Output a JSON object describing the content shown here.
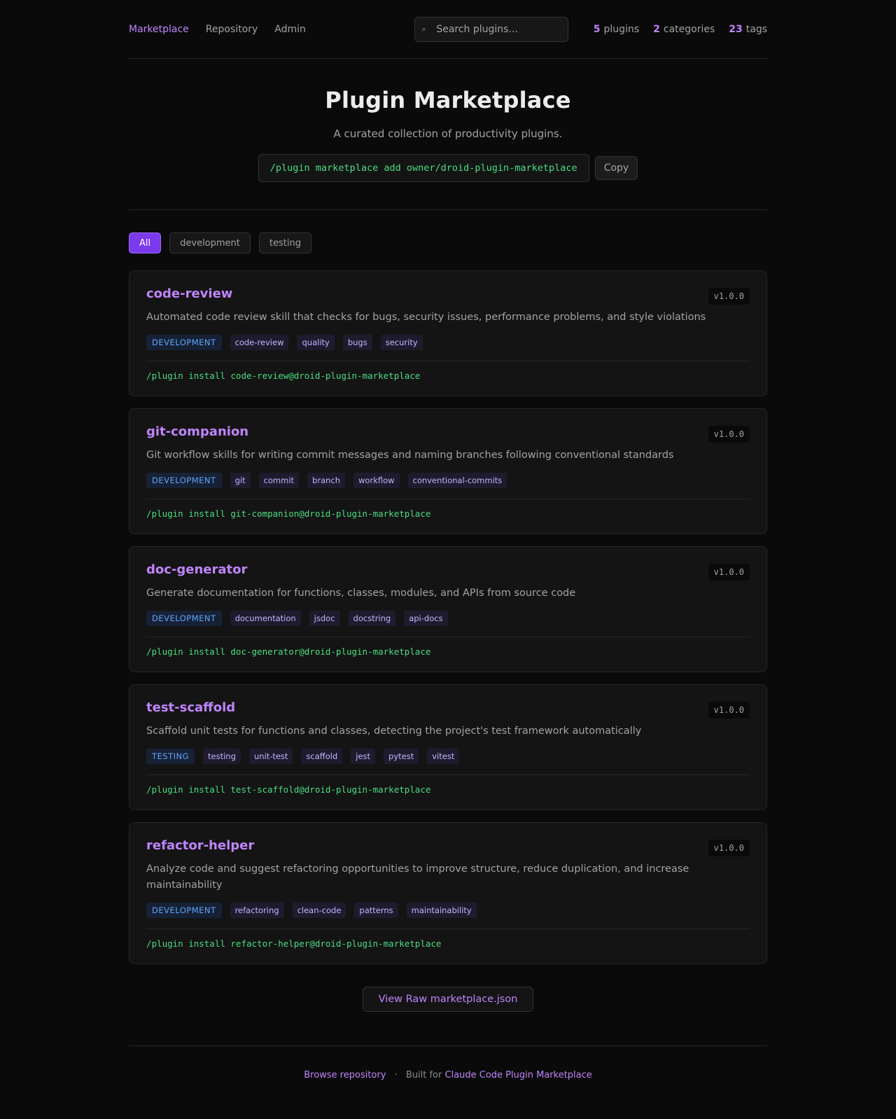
{
  "nav": {
    "links": [
      {
        "label": "Marketplace",
        "active": true
      },
      {
        "label": "Repository",
        "active": false
      },
      {
        "label": "Admin",
        "active": false
      }
    ],
    "search": {
      "icon": "search-icon",
      "placeholder": "Search plugins..."
    },
    "stats": [
      {
        "value": "5",
        "label": "plugins"
      },
      {
        "value": "2",
        "label": "categories"
      },
      {
        "value": "23",
        "label": "tags"
      }
    ]
  },
  "hero": {
    "title": "Plugin Marketplace",
    "subtitle": "A curated collection of productivity plugins.",
    "command": "/plugin marketplace add owner/droid-plugin-marketplace",
    "copy_label": "Copy"
  },
  "filters": [
    {
      "label": "All",
      "active": true
    },
    {
      "label": "development",
      "active": false
    },
    {
      "label": "testing",
      "active": false
    }
  ],
  "plugins": [
    {
      "name": "code-review",
      "version": "v1.0.0",
      "description": "Automated code review skill that checks for bugs, security issues, performance problems, and style violations",
      "category": "DEVELOPMENT",
      "tags": [
        "code-review",
        "quality",
        "bugs",
        "security"
      ],
      "install": "/plugin install code-review@droid-plugin-marketplace"
    },
    {
      "name": "git-companion",
      "version": "v1.0.0",
      "description": "Git workflow skills for writing commit messages and naming branches following conventional standards",
      "category": "DEVELOPMENT",
      "tags": [
        "git",
        "commit",
        "branch",
        "workflow",
        "conventional-commits"
      ],
      "install": "/plugin install git-companion@droid-plugin-marketplace"
    },
    {
      "name": "doc-generator",
      "version": "v1.0.0",
      "description": "Generate documentation for functions, classes, modules, and APIs from source code",
      "category": "DEVELOPMENT",
      "tags": [
        "documentation",
        "jsdoc",
        "docstring",
        "api-docs"
      ],
      "install": "/plugin install doc-generator@droid-plugin-marketplace"
    },
    {
      "name": "test-scaffold",
      "version": "v1.0.0",
      "description": "Scaffold unit tests for functions and classes, detecting the project's test framework automatically",
      "category": "TESTING",
      "tags": [
        "testing",
        "unit-test",
        "scaffold",
        "jest",
        "pytest",
        "vitest"
      ],
      "install": "/plugin install test-scaffold@droid-plugin-marketplace"
    },
    {
      "name": "refactor-helper",
      "version": "v1.0.0",
      "description": "Analyze code and suggest refactoring opportunities to improve structure, reduce duplication, and increase maintainability",
      "category": "DEVELOPMENT",
      "tags": [
        "refactoring",
        "clean-code",
        "patterns",
        "maintainability"
      ],
      "install": "/plugin install refactor-helper@droid-plugin-marketplace"
    }
  ],
  "raw_button": "View Raw marketplace.json",
  "footer": {
    "browse_label": "Browse repository",
    "separator": "·",
    "built_for_text": "Built for",
    "built_for_link": "Claude Code Plugin Marketplace"
  },
  "colors": {
    "background": "#0a0a0a",
    "accent": "#c084fc",
    "accent_active": "#7c3aed",
    "command": "#4ade80",
    "category": "#60a5fa"
  }
}
